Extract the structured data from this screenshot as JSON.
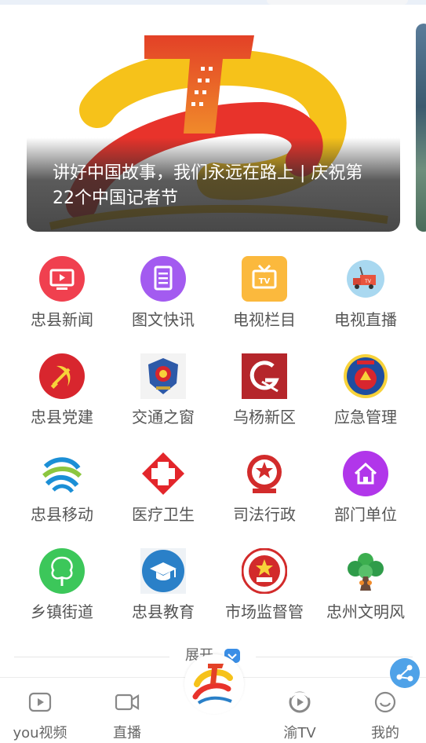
{
  "banner": {
    "title": "讲好中国故事，我们永远在路上 | 庆祝第22个中国记者节"
  },
  "grid": [
    {
      "label": "忠县新闻",
      "icon": "tv-icon",
      "color": "#f0404f"
    },
    {
      "label": "图文快讯",
      "icon": "document-icon",
      "color": "#a35bf0"
    },
    {
      "label": "电视栏目",
      "icon": "tv-channel-icon",
      "color": "#fbb93d"
    },
    {
      "label": "电视直播",
      "icon": "live-truck-icon",
      "color": "#8fc9ea"
    },
    {
      "label": "忠县党建",
      "icon": "party-emblem-icon",
      "color": "#d8262e"
    },
    {
      "label": "交通之窗",
      "icon": "police-emblem-icon",
      "color": "#2e5aa8"
    },
    {
      "label": "乌杨新区",
      "icon": "wuyang-logo-icon",
      "color": "#b5262b"
    },
    {
      "label": "应急管理",
      "icon": "emergency-emblem-icon",
      "color": "#1e4da0"
    },
    {
      "label": "忠县移动",
      "icon": "china-mobile-icon",
      "color": "#1b8fd6"
    },
    {
      "label": "医疗卫生",
      "icon": "red-cross-icon",
      "color": "#e3262b"
    },
    {
      "label": "司法行政",
      "icon": "national-emblem-icon",
      "color": "#d22b2b"
    },
    {
      "label": "部门单位",
      "icon": "home-icon",
      "color": "#b136ea"
    },
    {
      "label": "乡镇街道",
      "icon": "tree-icon",
      "color": "#3cc75a"
    },
    {
      "label": "忠县教育",
      "icon": "graduation-cap-icon",
      "color": "#2a80c8"
    },
    {
      "label": "市场监督管",
      "icon": "market-supervision-emblem-icon",
      "color": "#d22b2b"
    },
    {
      "label": "忠州文明风",
      "icon": "civilization-tree-icon",
      "color": "#2f9c4a"
    }
  ],
  "expand": {
    "label": "展开"
  },
  "tabbar": {
    "items": [
      {
        "label": "you视频",
        "icon": "video-play-icon"
      },
      {
        "label": "直播",
        "icon": "camera-icon"
      },
      {
        "label": "渝TV",
        "icon": "yutv-icon"
      },
      {
        "label": "我的",
        "icon": "smile-icon"
      }
    ],
    "center_icon": "app-logo-icon"
  },
  "share": {
    "icon": "share-icon"
  }
}
